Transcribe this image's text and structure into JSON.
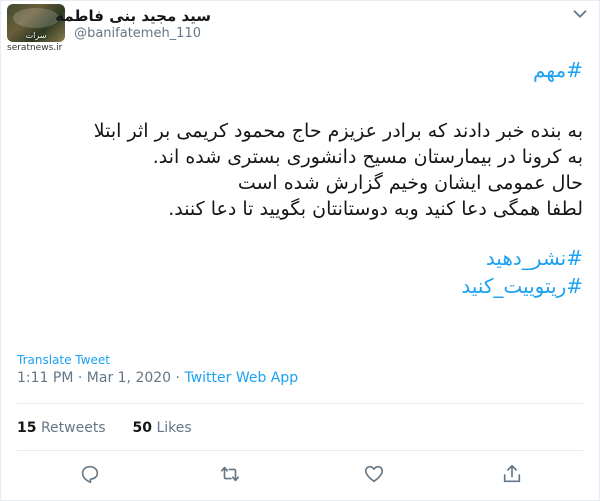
{
  "tweet": {
    "author_name": "سید مجید بنی فاطمه",
    "author_handle": "@banifatemeh_110",
    "hashtag_top": "#مهم",
    "body_lines": [
      "به بنده خبر دادند که برادر عزیزم حاج محمود کریمی بر اثر ابتلا",
      "به کرونا در بیمارستان مسیح دانشوری بستری شده اند.",
      "حال عمومی ایشان وخیم گزارش شده است",
      "لطفا همگی دعا کنید وبه دوستانتان بگویید تا دعا کنند."
    ],
    "hashtags_bottom": [
      "#نشر_دهید",
      "#ریتوییت_کنید"
    ],
    "translate_label": "Translate Tweet",
    "time": "1:11 PM",
    "date": "Mar 1, 2020",
    "separator": "·",
    "source_app": "Twitter Web App",
    "retweets_count": "15",
    "retweets_label": "Retweets",
    "likes_count": "50",
    "likes_label": "Likes"
  },
  "watermark": "seratnews.ir",
  "avatar_logo_text": "سرات",
  "icons": [
    "chevron-down-icon",
    "reply-icon",
    "retweet-icon",
    "like-icon",
    "share-icon"
  ],
  "colors": {
    "accent": "#1da1f2",
    "muted": "#657786",
    "text": "#14171a",
    "divider": "#e6ecf0"
  }
}
